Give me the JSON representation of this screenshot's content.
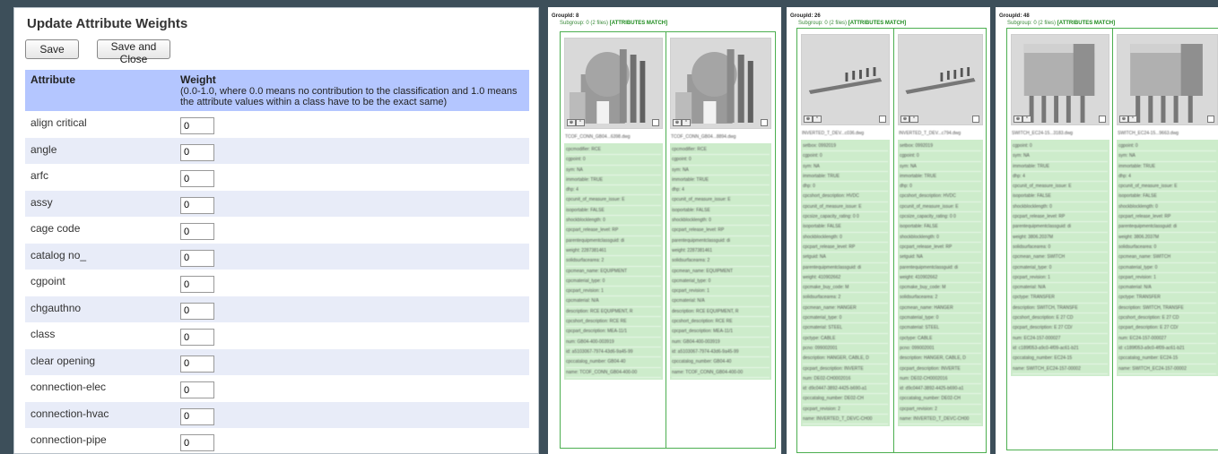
{
  "dialog": {
    "title": "Update Attribute Weights",
    "save_label": "Save",
    "save_close_label": "Save and Close",
    "header": {
      "attribute": "Attribute",
      "weight": "Weight",
      "weight_hint": "(0.0-1.0, where 0.0 means no contribution to the classification and 1.0 means the attribute values within a class have to be the exact same)"
    },
    "rows": [
      {
        "name": "align critical",
        "value": "0"
      },
      {
        "name": "angle",
        "value": "0"
      },
      {
        "name": "arfc",
        "value": "0"
      },
      {
        "name": "assy",
        "value": "0"
      },
      {
        "name": "cage code",
        "value": "0"
      },
      {
        "name": "catalog no_",
        "value": "0"
      },
      {
        "name": "cgpoint",
        "value": "0"
      },
      {
        "name": "chgauthno",
        "value": "0"
      },
      {
        "name": "class",
        "value": "0"
      },
      {
        "name": "clear opening",
        "value": "0"
      },
      {
        "name": "connection-elec",
        "value": "0"
      },
      {
        "name": "connection-hvac",
        "value": "0"
      },
      {
        "name": "connection-pipe",
        "value": "0"
      }
    ]
  },
  "groups": [
    {
      "group_id": "GroupId: 8",
      "subgroup_text": "Subgroup: 0 (2 files)",
      "match_text": "[ATTRIBUTES MATCH]",
      "shape": "motor",
      "items": [
        {
          "file": "TCOF_CONN_GB04...6398.dwg"
        },
        {
          "file": "TCOF_CONN_GB04...8894.dwg"
        }
      ],
      "props": [
        "cpcmodifier: RCE",
        "cgpoint: 0",
        "sym: NA",
        "immortable: TRUE",
        "dhp: 4",
        "cpcunit_of_measure_issue: E",
        "isoportable: FALSE",
        "shockblocklength: 0",
        "cpcpart_release_level: RP",
        "parentequipmentclassguid: di",
        "weight: 2287381461",
        "solidsurfacearea: 2",
        "cpcmean_name: EQUIPMENT",
        "cpcmaterial_type: 0",
        "cpcpart_revision: 1",
        "cpcmaterial: N/A",
        "description: RCE EQUIPMENT, R",
        "cpcshort_description: RCE RE",
        "cpcpart_description: MEA-11/1",
        "num: GB04-400-003919",
        "id: a5103067-7974-43d6-9a45-99",
        "cpccatalog_number: GB04-40",
        "name: TCOF_CONN_GB04-400-00"
      ]
    },
    {
      "group_id": "GroupId: 26",
      "subgroup_text": "Subgroup: 0 (2 files)",
      "match_text": "[ATTRIBUTES MATCH]",
      "shape": "comb",
      "items": [
        {
          "file": "INVERTED_T_DEV...c036.dwg"
        },
        {
          "file": "INVERTED_T_DEV...c794.dwg"
        }
      ],
      "props": [
        "setbox: 0992019",
        "cgpoint: 0",
        "sym: NA",
        "immortable: TRUE",
        "dhp: 0",
        "cpcshort_description: HVDC",
        "cpcunit_of_measure_issue: E",
        "cpcsize_capacity_rating: 0 0",
        "isoportable: FALSE",
        "shockblocklength: 0",
        "cpcpart_release_level: RP",
        "setguid: NA",
        "parentequipmentclassguid: di",
        "weight: 410902662",
        "cpcmake_buy_code: M",
        "solidsurfacearea: 2",
        "cpcmean_name: HANGER",
        "cpcmaterial_type: 0",
        "cpcmaterial: STEEL",
        "cpctype: CABLE",
        "pcno: 099002001",
        "description: HANGER, CABLE, D",
        "cpcpart_description: INVERTE",
        "num: DE02-CH0002016",
        "id: d9c0447-3892-4425-b690-a1",
        "cpccatalog_number: DE02-CH",
        "cpcpart_revision: 2",
        "name: INVERTED_T_DEVC-CH00"
      ]
    },
    {
      "group_id": "GroupId: 48",
      "subgroup_text": "Subgroup: 0 (2 files)",
      "match_text": "[ATTRIBUTES MATCH]",
      "shape": "switch",
      "items": [
        {
          "file": "SWITCH_EC24-15...3183.dwg"
        },
        {
          "file": "SWITCH_EC24-15...9663.dwg"
        }
      ],
      "props": [
        "cgpoint: 0",
        "sym: NA",
        "immortable: TRUE",
        "dhp: 4",
        "cpcunit_of_measure_issue: E",
        "isoportable: FALSE",
        "shockblocklength: 0",
        "cpcpart_release_level: RP",
        "parentequipmentclassguid: di",
        "weight: 3806.2037M",
        "solidsurfacearea: 0",
        "cpcmean_name: SWITCH",
        "cpcmaterial_type: 0",
        "cpcpart_revision: 1",
        "cpcmaterial: N/A",
        "cpctype: TRANSFER",
        "description: SWITCH, TRANSFE",
        "cpcshort_description: E 27 CD",
        "cpcpart_description: E 27 CD/",
        "num: EC24-157-000027",
        "id: c189f053-a9c0-4f09-ac61-b21",
        "cpccatalog_number: EC24-15",
        "name: SWITCH_EC24-157-00002"
      ]
    }
  ]
}
